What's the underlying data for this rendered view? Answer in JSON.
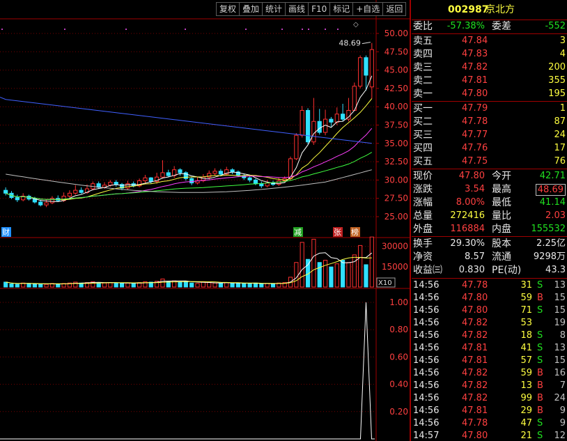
{
  "toolbar": [
    "复权",
    "叠加",
    "统计",
    "画线",
    "F10",
    "标记",
    "+自选",
    "返回"
  ],
  "stock": {
    "code": "002987",
    "name": "京北方"
  },
  "wei": {
    "bi_label": "委比",
    "bi": "-57.38%",
    "cha_label": "委差",
    "cha": "-552"
  },
  "asks": [
    {
      "label": "卖五",
      "price": "47.84",
      "vol": "3"
    },
    {
      "label": "卖四",
      "price": "47.83",
      "vol": "4"
    },
    {
      "label": "卖三",
      "price": "47.82",
      "vol": "200"
    },
    {
      "label": "卖二",
      "price": "47.81",
      "vol": "355"
    },
    {
      "label": "卖一",
      "price": "47.80",
      "vol": "195"
    }
  ],
  "bids": [
    {
      "label": "买一",
      "price": "47.79",
      "vol": "1"
    },
    {
      "label": "买二",
      "price": "47.78",
      "vol": "87"
    },
    {
      "label": "买三",
      "price": "47.77",
      "vol": "24"
    },
    {
      "label": "买四",
      "price": "47.76",
      "vol": "17"
    },
    {
      "label": "买五",
      "price": "47.75",
      "vol": "76"
    }
  ],
  "quote": [
    {
      "l1": "现价",
      "v1": "47.80",
      "c1": "red",
      "l2": "今开",
      "v2": "42.71",
      "c2": "green"
    },
    {
      "l1": "涨跌",
      "v1": "3.54",
      "c1": "red",
      "l2": "最高",
      "v2": "48.69",
      "c2": "red"
    },
    {
      "l1": "涨幅",
      "v1": "8.00%",
      "c1": "red",
      "l2": "最低",
      "v2": "41.14",
      "c2": "green"
    },
    {
      "l1": "总量",
      "v1": "272416",
      "c1": "yellow",
      "l2": "量比",
      "v2": "2.03",
      "c2": "red"
    },
    {
      "l1": "外盘",
      "v1": "116884",
      "c1": "red",
      "l2": "内盘",
      "v2": "155532",
      "c2": "green"
    }
  ],
  "info": [
    {
      "l1": "换手",
      "v1": "29.30%",
      "l2": "股本",
      "v2": "2.25亿"
    },
    {
      "l1": "净资",
      "v1": "8.57",
      "l2": "流通",
      "v2": "9298万"
    },
    {
      "l1": "收益㈢",
      "v1": "0.830",
      "l2": "PE(动)",
      "v2": "43.3"
    }
  ],
  "ticks": [
    {
      "t": "14:56",
      "p": "47.78",
      "v": "31",
      "d": "S",
      "n": "13"
    },
    {
      "t": "14:56",
      "p": "47.80",
      "v": "59",
      "d": "B",
      "n": "15"
    },
    {
      "t": "14:56",
      "p": "47.80",
      "v": "71",
      "d": "S",
      "n": "15"
    },
    {
      "t": "14:56",
      "p": "47.82",
      "v": "53",
      "d": "",
      "n": "19"
    },
    {
      "t": "14:56",
      "p": "47.82",
      "v": "18",
      "d": "S",
      "n": "8"
    },
    {
      "t": "14:56",
      "p": "47.81",
      "v": "41",
      "d": "S",
      "n": "13"
    },
    {
      "t": "14:56",
      "p": "47.81",
      "v": "57",
      "d": "S",
      "n": "15"
    },
    {
      "t": "14:56",
      "p": "47.82",
      "v": "59",
      "d": "B",
      "n": "16"
    },
    {
      "t": "14:56",
      "p": "47.82",
      "v": "13",
      "d": "B",
      "n": "7"
    },
    {
      "t": "14:56",
      "p": "47.82",
      "v": "99",
      "d": "B",
      "n": "24"
    },
    {
      "t": "14:56",
      "p": "47.81",
      "v": "29",
      "d": "B",
      "n": "9"
    },
    {
      "t": "14:56",
      "p": "47.78",
      "v": "47",
      "d": "S",
      "n": "9"
    },
    {
      "t": "14:57",
      "p": "47.80",
      "v": "21",
      "d": "S",
      "n": "12"
    }
  ],
  "chart_data": [
    {
      "type": "candlestick",
      "price_axis": [
        "50.00",
        "47.50",
        "45.00",
        "42.50",
        "40.00",
        "37.50",
        "35.00",
        "32.50",
        "30.00",
        "27.50",
        "25.00"
      ],
      "ylim": [
        25.0,
        50.0
      ],
      "high_label": "48.69",
      "markers": [
        "财",
        "减",
        "张",
        "榜"
      ],
      "candles": [
        [
          28.6,
          28.2,
          29.0,
          27.9
        ],
        [
          28.2,
          27.6,
          28.5,
          27.4
        ],
        [
          27.6,
          27.3,
          28.0,
          27.0
        ],
        [
          27.3,
          27.8,
          28.2,
          27.1
        ],
        [
          27.8,
          27.4,
          28.0,
          27.2
        ],
        [
          27.4,
          27.0,
          27.7,
          26.8
        ],
        [
          27.0,
          26.6,
          27.3,
          26.4
        ],
        [
          26.6,
          26.9,
          27.3,
          26.3
        ],
        [
          26.9,
          27.5,
          27.8,
          26.7
        ],
        [
          27.5,
          27.2,
          27.9,
          27.0
        ],
        [
          27.2,
          27.8,
          28.3,
          27.0
        ],
        [
          27.8,
          28.2,
          28.6,
          27.6
        ],
        [
          28.2,
          28.6,
          29.3,
          28.0
        ],
        [
          28.6,
          28.3,
          29.0,
          28.1
        ],
        [
          28.3,
          28.8,
          29.4,
          28.1
        ],
        [
          28.8,
          29.5,
          29.8,
          28.6
        ],
        [
          29.5,
          29.0,
          29.8,
          28.8
        ],
        [
          29.0,
          29.3,
          29.7,
          28.8
        ],
        [
          29.3,
          29.7,
          30.0,
          29.1
        ],
        [
          29.7,
          29.4,
          30.0,
          29.1
        ],
        [
          29.4,
          28.9,
          29.6,
          28.6
        ],
        [
          28.9,
          29.5,
          29.9,
          28.7
        ],
        [
          29.5,
          29.2,
          29.8,
          29.0
        ],
        [
          29.2,
          29.9,
          30.2,
          29.0
        ],
        [
          29.9,
          30.3,
          30.7,
          29.6
        ],
        [
          30.3,
          29.8,
          30.4,
          29.5
        ],
        [
          29.8,
          30.4,
          31.0,
          29.5
        ],
        [
          30.4,
          31.0,
          32.7,
          30.2
        ],
        [
          31.0,
          30.6,
          31.4,
          30.4
        ],
        [
          30.6,
          31.4,
          31.9,
          30.3
        ],
        [
          31.4,
          31.0,
          31.6,
          30.6
        ],
        [
          31.0,
          30.2,
          31.2,
          29.9
        ],
        [
          30.2,
          29.6,
          30.4,
          29.3
        ],
        [
          29.6,
          29.9,
          30.4,
          29.4
        ],
        [
          29.9,
          30.4,
          30.8,
          29.7
        ],
        [
          30.4,
          30.9,
          31.3,
          30.1
        ],
        [
          30.9,
          31.2,
          31.6,
          30.6
        ],
        [
          31.2,
          30.8,
          31.5,
          30.5
        ],
        [
          30.8,
          31.4,
          31.8,
          30.6
        ],
        [
          31.4,
          31.1,
          31.6,
          30.8
        ],
        [
          31.1,
          30.6,
          31.3,
          30.4
        ],
        [
          30.6,
          30.3,
          30.9,
          30.0
        ],
        [
          30.3,
          30.0,
          30.5,
          29.7
        ],
        [
          30.0,
          29.5,
          30.2,
          29.3
        ],
        [
          29.5,
          29.2,
          29.8,
          28.9
        ],
        [
          29.2,
          29.6,
          30.0,
          29.0
        ],
        [
          29.6,
          29.4,
          29.9,
          29.2
        ],
        [
          29.4,
          29.9,
          30.3,
          29.2
        ],
        [
          29.9,
          30.2,
          30.5,
          29.7
        ],
        [
          30.2,
          32.9,
          33.2,
          30.0
        ],
        [
          32.9,
          36.1,
          36.4,
          32.7
        ],
        [
          36.1,
          39.5,
          40.1,
          35.8
        ],
        [
          39.5,
          35.2,
          39.8,
          34.9
        ],
        [
          35.2,
          38.0,
          41.2,
          34.8
        ],
        [
          38.0,
          36.5,
          39.7,
          36.2
        ],
        [
          36.5,
          38.3,
          39.6,
          36.1
        ],
        [
          38.3,
          37.9,
          38.6,
          37.3
        ],
        [
          37.9,
          39.0,
          39.9,
          37.5
        ],
        [
          39.0,
          38.3,
          40.4,
          38.0
        ],
        [
          38.3,
          39.5,
          41.2,
          38.0
        ],
        [
          39.5,
          42.8,
          43.3,
          39.5
        ],
        [
          42.8,
          46.7,
          47.0,
          42.5
        ],
        [
          46.7,
          44.3,
          47.0,
          42.2
        ],
        [
          42.7,
          47.8,
          48.7,
          41.1
        ]
      ],
      "volume_axis": [
        "30000",
        "15000"
      ],
      "volume_unit": "X10",
      "volumes": [
        0.11,
        0.07,
        0.06,
        0.09,
        0.08,
        0.07,
        0.06,
        0.06,
        0.08,
        0.07,
        0.08,
        0.09,
        0.11,
        0.09,
        0.1,
        0.12,
        0.1,
        0.09,
        0.1,
        0.09,
        0.08,
        0.09,
        0.08,
        0.1,
        0.12,
        0.11,
        0.13,
        0.18,
        0.12,
        0.14,
        0.11,
        0.13,
        0.09,
        0.08,
        0.11,
        0.1,
        0.09,
        0.08,
        0.1,
        0.09,
        0.09,
        0.08,
        0.07,
        0.09,
        0.07,
        0.08,
        0.07,
        0.09,
        0.1,
        0.22,
        0.55,
        1.0,
        0.62,
        1.07,
        0.55,
        0.6,
        0.45,
        0.52,
        0.6,
        0.55,
        0.72,
        0.93,
        0.5,
        1.12
      ],
      "indicator_axis": [
        "1.00",
        "0.80",
        "0.60",
        "0.40",
        "0.20"
      ],
      "indicator": {
        "index": 62,
        "value": 1.0
      }
    }
  ]
}
